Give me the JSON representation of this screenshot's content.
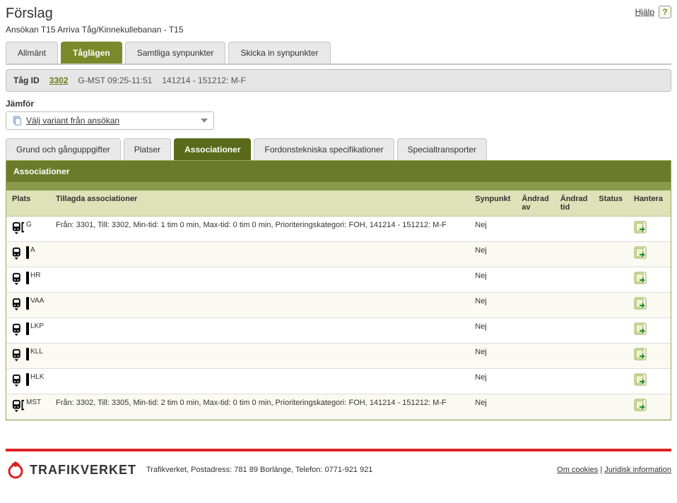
{
  "header": {
    "title": "Förslag",
    "subtitle": "Ansökan T15 Arriva Tåg/Kinnekullebanan - T15",
    "help_label": "Hjälp",
    "help_badge": "?"
  },
  "main_tabs": [
    {
      "label": "Allmänt"
    },
    {
      "label": "Tåglägen"
    },
    {
      "label": "Samtliga synpunkter"
    },
    {
      "label": "Skicka in synpunkter"
    }
  ],
  "infobar": {
    "tag_id_label": "Tåg ID",
    "train_number": "3302",
    "route_time": "G-MST 09:25-11:51",
    "date_days": "141214 - 151212: M-F"
  },
  "compare": {
    "label": "Jämför",
    "dropdown_text": "Välj variant från ansökan"
  },
  "sub_tabs": [
    {
      "label": "Grund och gånguppgifter"
    },
    {
      "label": "Platser"
    },
    {
      "label": "Associationer"
    },
    {
      "label": "Fordonstekniska specifikationer"
    },
    {
      "label": "Specialtransporter"
    }
  ],
  "panel": {
    "title": "Associationer"
  },
  "table": {
    "headers": {
      "plats": "Plats",
      "tillagda": "Tillagda associationer",
      "synpunkt": "Synpunkt",
      "andrad_av": "Ändrad av",
      "andrad_tid": "Ändrad tid",
      "status": "Status",
      "hantera": "Hantera"
    },
    "rows": [
      {
        "plats": "G",
        "endpoint": true,
        "desc": "Från: 3301, Till: 3302, Min-tid: 1 tim 0 min, Max-tid: 0 tim 0 min, Prioriteringskategori: FOH, 141214 - 151212: M-F",
        "synpunkt": "Nej",
        "andrad_av": "",
        "andrad_tid": "",
        "status": ""
      },
      {
        "plats": "A",
        "endpoint": false,
        "desc": "",
        "synpunkt": "Nej",
        "andrad_av": "",
        "andrad_tid": "",
        "status": ""
      },
      {
        "plats": "HR",
        "endpoint": false,
        "desc": "",
        "synpunkt": "Nej",
        "andrad_av": "",
        "andrad_tid": "",
        "status": ""
      },
      {
        "plats": "VAA",
        "endpoint": false,
        "desc": "",
        "synpunkt": "Nej",
        "andrad_av": "",
        "andrad_tid": "",
        "status": ""
      },
      {
        "plats": "LKP",
        "endpoint": false,
        "desc": "",
        "synpunkt": "Nej",
        "andrad_av": "",
        "andrad_tid": "",
        "status": ""
      },
      {
        "plats": "KLL",
        "endpoint": false,
        "desc": "",
        "synpunkt": "Nej",
        "andrad_av": "",
        "andrad_tid": "",
        "status": ""
      },
      {
        "plats": "HLK",
        "endpoint": false,
        "desc": "",
        "synpunkt": "Nej",
        "andrad_av": "",
        "andrad_tid": "",
        "status": ""
      },
      {
        "plats": "MST",
        "endpoint": true,
        "desc": "Från: 3302, Till: 3305, Min-tid: 2 tim 0 min, Max-tid: 0 tim 0 min, Prioriteringskategori: FOH, 141214 - 151212: M-F",
        "synpunkt": "Nej",
        "andrad_av": "",
        "andrad_tid": "",
        "status": ""
      }
    ]
  },
  "footer": {
    "brand": "TRAFIKVERKET",
    "address": "Trafikverket, Postadress: 781 89 Borlänge, Telefon: 0771-921 921",
    "link_cookies": "Om cookies",
    "link_legal": "Juridisk information"
  }
}
